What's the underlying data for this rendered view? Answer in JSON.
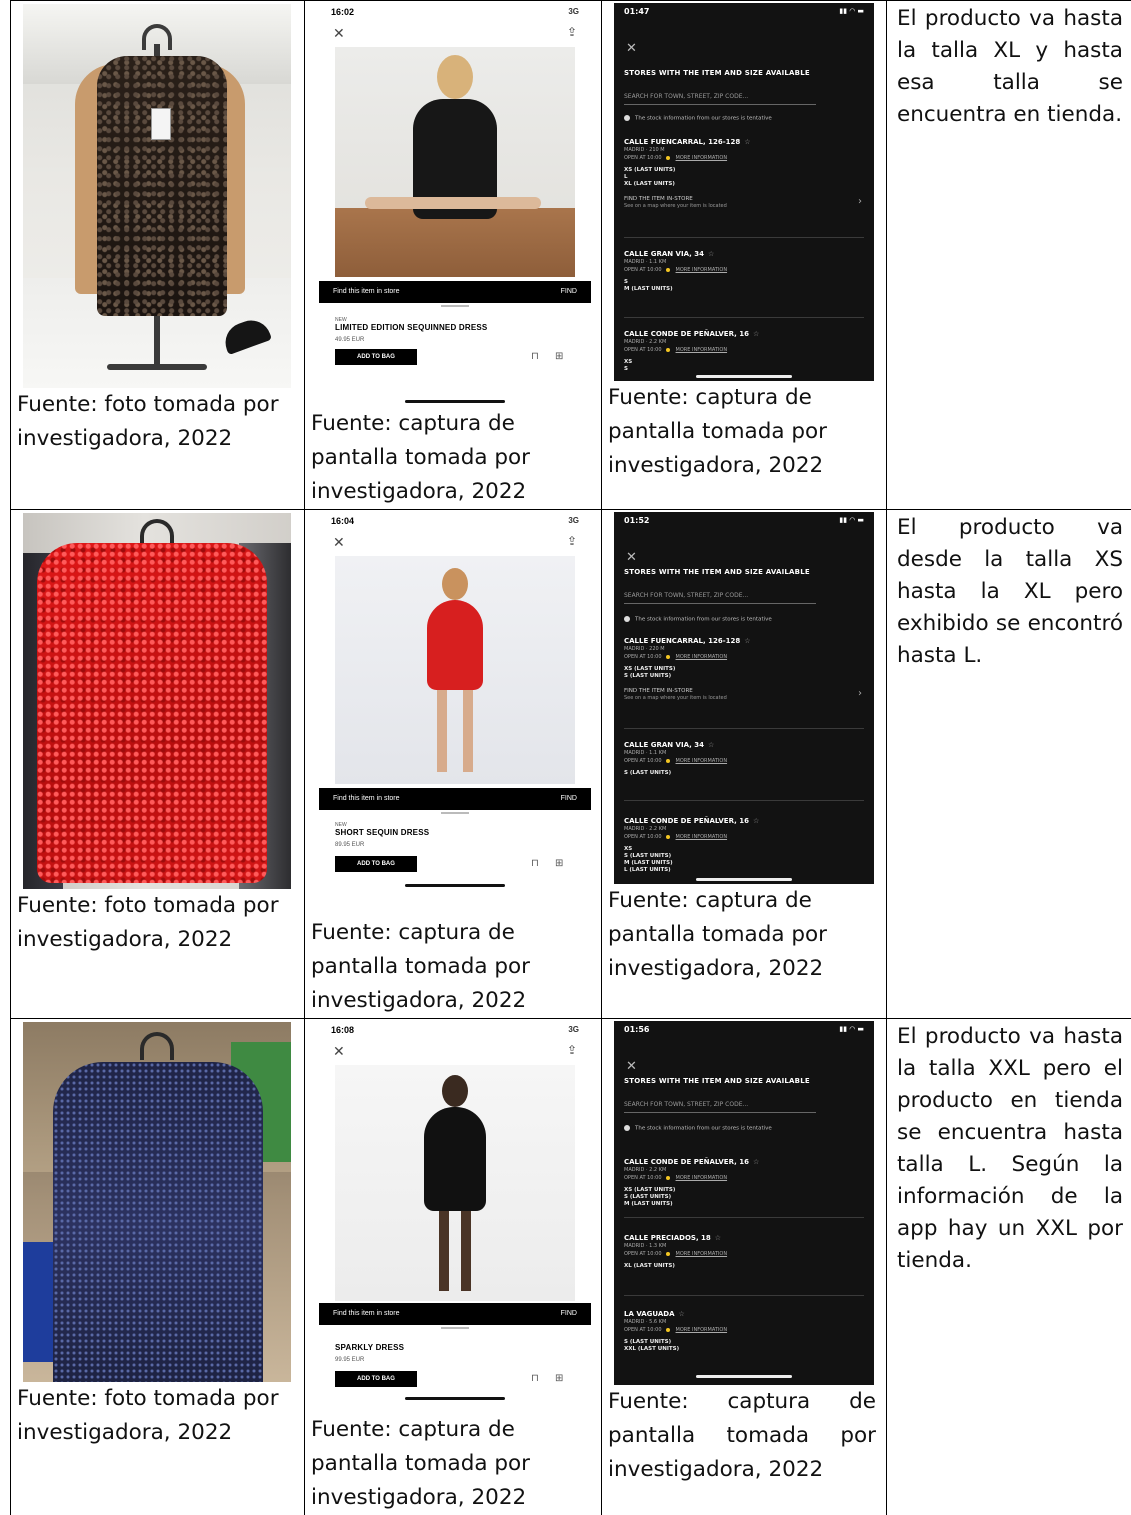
{
  "rows": [
    {
      "photo_caption": "Fuente: foto tomada por investigadora, 2022",
      "product": {
        "status_time": "16:02",
        "status_signal": "3G",
        "find_label": "Find this item in store",
        "find_button": "FIND",
        "badge": "NEW",
        "name": "LIMITED EDITION SEQUINNED DRESS",
        "price": "49.95 EUR",
        "add_label": "ADD TO BAG"
      },
      "product_caption": "Fuente: captura de pantalla tomada por investigadora, 2022",
      "stock": {
        "status_time": "01:47",
        "title": "STORES WITH THE ITEM AND SIZE AVAILABLE",
        "search_placeholder": "SEARCH FOR TOWN, STREET, ZIP CODE...",
        "info": "The stock information from our stores is tentative",
        "stores": [
          {
            "name": "CALLE FUENCARRAL, 126-128",
            "distance": "MADRID · 210 M",
            "open": "OPEN AT 10:00",
            "more": "MORE INFORMATION",
            "sizes": [
              "XS (LAST UNITS)",
              "L",
              "XL (LAST UNITS)"
            ],
            "find_title": "FIND THE ITEM IN-STORE",
            "find_sub": "See on a map where your item is located"
          },
          {
            "name": "CALLE GRAN VIA, 34",
            "distance": "MADRID · 1.1 KM",
            "open": "OPEN AT 10:00",
            "more": "MORE INFORMATION",
            "sizes": [
              "S",
              "M (LAST UNITS)"
            ]
          },
          {
            "name": "CALLE CONDE DE PEÑALVER, 16",
            "distance": "MADRID · 2.2 KM",
            "open": "OPEN AT 10:00",
            "more": "MORE INFORMATION",
            "sizes": [
              "XS",
              "S"
            ]
          }
        ]
      },
      "stock_caption": "Fuente: captura de pantalla tomada por investigadora, 2022",
      "note": "El producto va hasta la talla XL y hasta esa talla se encuentra en tienda."
    },
    {
      "photo_caption": "Fuente: foto tomada por investigadora, 2022",
      "product": {
        "status_time": "16:04",
        "status_signal": "3G",
        "find_label": "Find this item in store",
        "find_button": "FIND",
        "badge": "NEW",
        "name": "SHORT SEQUIN DRESS",
        "price": "89.95 EUR",
        "add_label": "ADD TO BAG"
      },
      "product_caption": "Fuente: captura de pantalla tomada por investigadora, 2022",
      "stock": {
        "status_time": "01:52",
        "title": "STORES WITH THE ITEM AND SIZE AVAILABLE",
        "search_placeholder": "SEARCH FOR TOWN, STREET, ZIP CODE...",
        "info": "The stock information from our stores is tentative",
        "stores": [
          {
            "name": "CALLE FUENCARRAL, 126-128",
            "distance": "MADRID · 220 M",
            "open": "OPEN AT 10:00",
            "more": "MORE INFORMATION",
            "sizes": [
              "XS (LAST UNITS)",
              "S (LAST UNITS)"
            ],
            "find_title": "FIND THE ITEM IN-STORE",
            "find_sub": "See on a map where your item is located"
          },
          {
            "name": "CALLE GRAN VIA, 34",
            "distance": "MADRID · 1.1 KM",
            "open": "OPEN AT 10:00",
            "more": "MORE INFORMATION",
            "sizes": [
              "S (LAST UNITS)"
            ]
          },
          {
            "name": "CALLE CONDE DE PEÑALVER, 16",
            "distance": "MADRID · 2.2 KM",
            "open": "OPEN AT 10:00",
            "more": "MORE INFORMATION",
            "sizes": [
              "XS",
              "S (LAST UNITS)",
              "M (LAST UNITS)",
              "L (LAST UNITS)"
            ]
          }
        ]
      },
      "stock_caption": "Fuente: captura de pantalla tomada por investigadora, 2022",
      "note": "El producto va desde la talla XS hasta la XL pero exhibido se encontró hasta L."
    },
    {
      "photo_caption": "Fuente: foto tomada por investigadora, 2022",
      "product": {
        "status_time": "16:08",
        "status_signal": "3G",
        "find_label": "Find this item in store",
        "find_button": "FIND",
        "badge": "",
        "name": "SPARKLY DRESS",
        "price": "99.95 EUR",
        "add_label": "ADD TO BAG"
      },
      "product_caption": "Fuente: captura de pantalla tomada por investigadora, 2022",
      "stock": {
        "status_time": "01:56",
        "title": "STORES WITH THE ITEM AND SIZE AVAILABLE",
        "search_placeholder": "SEARCH FOR TOWN, STREET, ZIP CODE...",
        "info": "The stock information from our stores is tentative",
        "stores": [
          {
            "name": "CALLE CONDE DE PEÑALVER, 16",
            "distance": "MADRID · 2.2 KM",
            "open": "OPEN AT 10:00",
            "more": "MORE INFORMATION",
            "sizes": [
              "XS (LAST UNITS)",
              "S (LAST UNITS)",
              "M (LAST UNITS)"
            ]
          },
          {
            "name": "CALLE PRECIADOS, 18",
            "distance": "MADRID · 1.3 KM",
            "open": "OPEN AT 10:00",
            "more": "MORE INFORMATION",
            "sizes": [
              "XL (LAST UNITS)"
            ]
          },
          {
            "name": "LA VAGUADA",
            "distance": "MADRID · 5.6 KM",
            "open": "OPEN AT 10:00",
            "more": "MORE INFORMATION",
            "sizes": [
              "S (LAST UNITS)",
              "XXL (LAST UNITS)"
            ]
          }
        ]
      },
      "stock_caption": "Fuente: captura de pantalla tomada por investigadora, 2022",
      "note": "El producto va hasta la talla XXL pero el producto en tienda se encuentra hasta talla L. Según la información de la app hay un XXL por tienda."
    }
  ]
}
